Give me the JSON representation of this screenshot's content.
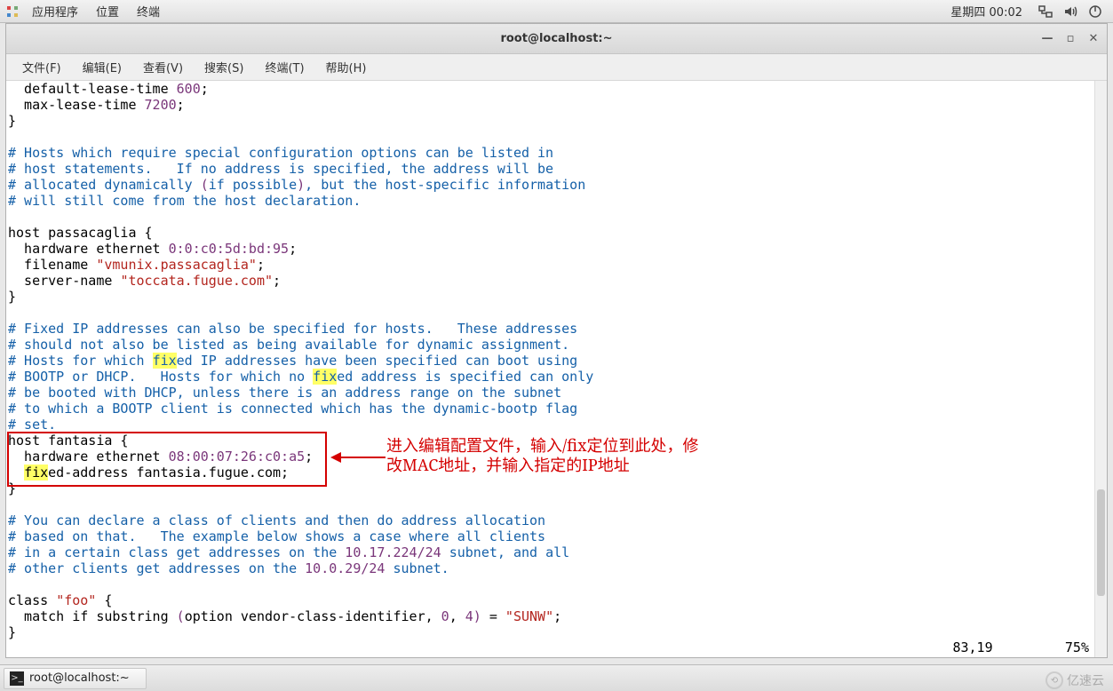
{
  "panel": {
    "apps": "应用程序",
    "places": "位置",
    "terminal": "终端",
    "clock": "星期四 00:02"
  },
  "window": {
    "title": "root@localhost:~"
  },
  "menubar": {
    "file": "文件(F)",
    "edit": "编辑(E)",
    "view": "查看(V)",
    "search": "搜索(S)",
    "terminal": "终端(T)",
    "help": "帮助(H)"
  },
  "term": {
    "l1a": "  default-lease-time ",
    "l1n": "600",
    "l1b": ";",
    "l2a": "  max-lease-time ",
    "l2n": "7200",
    "l2b": ";",
    "l3": "}",
    "c1": "# Hosts which require special configuration options can be listed in",
    "c2": "# host statements.   If no address is specified, the address will be",
    "c3a": "# allocated dynamically ",
    "c3b": "(",
    "c3c": "if possible",
    "c3d": ")",
    "c3e": ", but the host-specific information",
    "c4": "# will still come from the host declaration.",
    "h1": "host passacaglia {",
    "h2a": "  hardware ethernet ",
    "h2n": "0:0:c0:5d:bd:95",
    "h2b": ";",
    "h3a": "  filename ",
    "h3s": "\"vmunix.passacaglia\"",
    "h3b": ";",
    "h4a": "  server-name ",
    "h4s": "\"toccata.fugue.com\"",
    "h4b": ";",
    "h5": "}",
    "c5": "# Fixed IP addresses can also be specified for hosts.   These addresses",
    "c6": "# should not also be listed as being available for dynamic assignment.",
    "c7a": "# Hosts for which ",
    "c7h1": "f",
    "c7h2": "ix",
    "c7b": "ed IP addresses have been specified can boot using",
    "c8a": "# BOOTP or DHCP.   Hosts for which no ",
    "c8h": "fix",
    "c8b": "ed address is specified can only",
    "c9": "# be booted with DHCP, unless there is an address range on the subnet",
    "c10": "# to which a BOOTP client is connected which has the dynamic-bootp flag",
    "c11": "# set.",
    "f1": "host fantasia {",
    "f2a": "  hardware ethernet ",
    "f2n": "08:00:07:26:c0:a5",
    "f2b": ";",
    "f3a": "  ",
    "f3h": "fix",
    "f3b": "ed-address fantasia.fugue.com;",
    "f4": "}",
    "c12": "# You can declare a class of clients and then do address allocation",
    "c13": "# based on that.   The example below shows a case where all clients",
    "c14a": "# in a certain class get addresses on the ",
    "c14n": "10.17.224/24",
    "c14b": " subnet, and all",
    "c15a": "# other clients get addresses on the ",
    "c15n": "10.0.29/24",
    "c15b": " subnet.",
    "cl1a": "class ",
    "cl1s": "\"foo\"",
    "cl1b": " {",
    "cl2a": "  match if substring ",
    "cl2p1": "(",
    "cl2b": "option vendor-class-identifier, ",
    "cl2n1": "0",
    "cl2c": ", ",
    "cl2n2": "4",
    "cl2p2": ")",
    "cl2d": " = ",
    "cl2s": "\"SUNW\"",
    "cl2e": ";",
    "cl3": "}"
  },
  "annotation": {
    "line1": "进入编辑配置文件，输入/fix定位到此处，修",
    "line2": "改MAC地址，并输入指定的IP地址"
  },
  "status": {
    "pos": "83,19",
    "pct": "75%"
  },
  "taskbar": {
    "item": "root@localhost:~"
  },
  "watermark": {
    "text": "亿速云"
  }
}
